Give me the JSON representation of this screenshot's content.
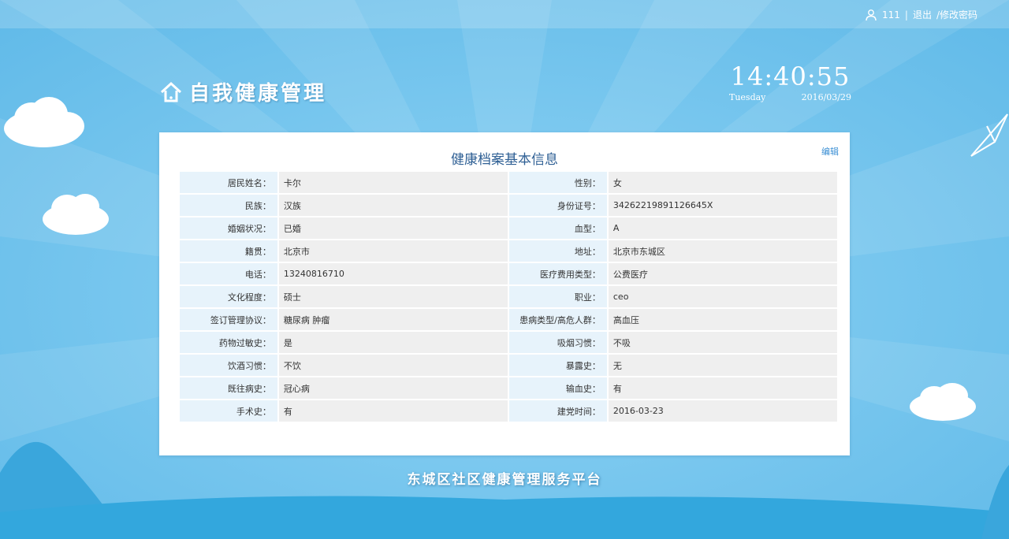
{
  "header": {
    "username": "111",
    "logout_label": "退出",
    "change_password_label": "/修改密码",
    "separator": "|"
  },
  "app": {
    "title": "自我健康管理"
  },
  "clock": {
    "time": "14:40:55",
    "weekday": "Tuesday",
    "date": "2016/03/29"
  },
  "card": {
    "title": "健康档案基本信息",
    "edit_label": "编辑",
    "rows": [
      {
        "l1": "居民姓名：",
        "v1": "卡尔",
        "l2": "性别：",
        "v2": "女"
      },
      {
        "l1": "民族：",
        "v1": "汉族",
        "l2": "身份证号：",
        "v2": "34262219891126645X"
      },
      {
        "l1": "婚姻状况：",
        "v1": "已婚",
        "l2": "血型：",
        "v2": "A"
      },
      {
        "l1": "籍贯：",
        "v1": "北京市",
        "l2": "地址：",
        "v2": "北京市东城区"
      },
      {
        "l1": "电话：",
        "v1": "13240816710",
        "l2": "医疗费用类型：",
        "v2": "公费医疗"
      },
      {
        "l1": "文化程度：",
        "v1": "硕士",
        "l2": "职业：",
        "v2": "ceo"
      },
      {
        "l1": "签订管理协议：",
        "v1": "糖尿病 肿瘤",
        "l2": "患病类型/高危人群：",
        "v2": "高血压"
      },
      {
        "l1": "药物过敏史：",
        "v1": "是",
        "l2": "吸烟习惯：",
        "v2": "不吸"
      },
      {
        "l1": "饮酒习惯：",
        "v1": "不饮",
        "l2": "暴露史：",
        "v2": "无"
      },
      {
        "l1": "既往病史：",
        "v1": "冠心病",
        "l2": "输血史：",
        "v2": "有"
      },
      {
        "l1": "手术史：",
        "v1": "有",
        "l2": "建党时间：",
        "v2": "2016-03-23"
      }
    ]
  },
  "footer": {
    "title": "东城区社区健康管理服务平台"
  },
  "colors": {
    "sky": "#76c6ee",
    "ground": "#33a7dd",
    "title_blue": "#2e5f94",
    "label_bg": "#e7f3fb",
    "value_bg": "#efefef"
  }
}
